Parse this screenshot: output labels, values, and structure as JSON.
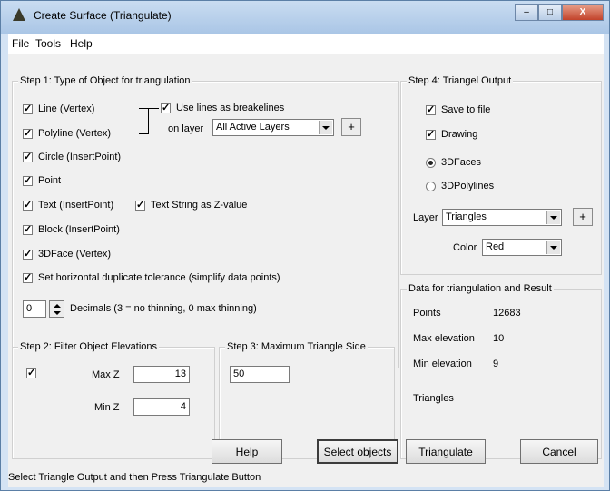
{
  "window": {
    "title": "Create Surface (Triangulate)",
    "icon": "triangle-app-icon",
    "caption_buttons": {
      "minimize": "–",
      "maximize": "□",
      "close": "X"
    }
  },
  "menu": {
    "file": "File",
    "tools": "Tools",
    "help": "Help"
  },
  "step1": {
    "title": "Step 1: Type of Object for triangulation",
    "line": "Line (Vertex)",
    "polyline": "Polyline (Vertex)",
    "use_breaklines": "Use lines as breakelines",
    "on_layer": "on layer",
    "layer_value": "All Active Layers",
    "plus": "+",
    "circle": "Circle (InsertPoint)",
    "point": "Point",
    "text": "Text (InsertPoint)",
    "text_z": "Text String as Z-value",
    "block": "Block (InsertPoint)",
    "face3d": "3DFace (Vertex)",
    "tolerance": "Set horizontal duplicate tolerance (simplify data points)",
    "decimals_value": "0",
    "decimals_label": "Decimals (3 = no thinning, 0 max thinning)"
  },
  "step2": {
    "title": "Step 2: Filter Object Elevations",
    "max_label": "Max Z",
    "max_value": "13",
    "min_label": "Min Z",
    "min_value": "4"
  },
  "step3": {
    "title": "Step 3: Maximum Triangle Side",
    "value": "50"
  },
  "step4": {
    "title": "Step 4: Triangel Output",
    "save_to_file": "Save to file",
    "drawing": "Drawing",
    "faces3d": "3DFaces",
    "polylines3d": "3DPolylines",
    "layer_label": "Layer",
    "layer_value": "Triangles",
    "plus": "+",
    "color_label": "Color",
    "color_value": "Red"
  },
  "result": {
    "title": "Data for triangulation and Result",
    "points_label": "Points",
    "points_value": "12683",
    "max_elev_label": "Max elevation",
    "max_elev_value": "10",
    "min_elev_label": "Min elevation",
    "min_elev_value": "9",
    "triangles_label": "Triangles"
  },
  "buttons": {
    "help": "Help",
    "select": "Select objects",
    "triangulate": "Triangulate",
    "cancel": "Cancel"
  },
  "status": "Select Triangle Output and then Press Triangulate Button"
}
